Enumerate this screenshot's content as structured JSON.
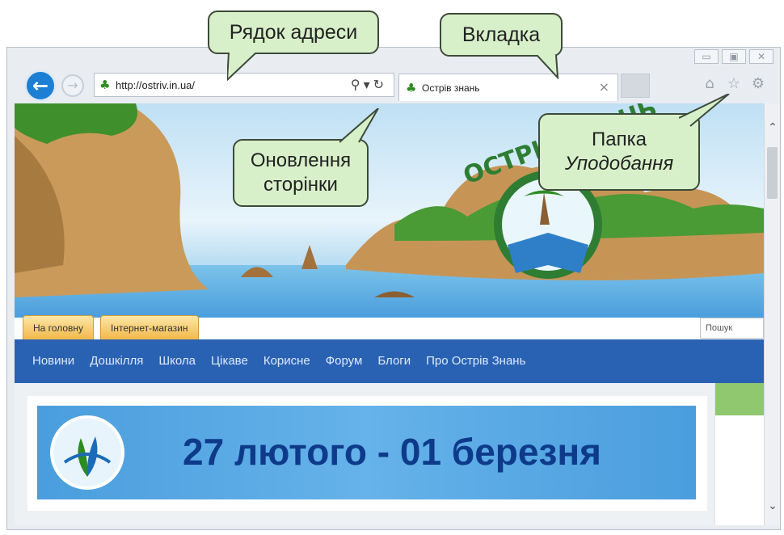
{
  "callouts": {
    "address_bar": "Рядок адреси",
    "tab": "Вкладка",
    "refresh_line1": "Оновлення",
    "refresh_line2": "сторінки",
    "favorites_line1": "Папка",
    "favorites_line2": "Уподобання"
  },
  "browser": {
    "url": "http://ostriv.in.ua/",
    "tab_title": "Острів знань",
    "window_buttons": [
      "▭",
      "▣",
      "✕"
    ]
  },
  "site": {
    "logo_text": "ОСТРІВ ЗНАНЬ",
    "top_tabs": [
      "На головну",
      "Інтернет-магазин"
    ],
    "search_placeholder": "Пошук",
    "menu": [
      "Новини",
      "Дошкілля",
      "Школа",
      "Цікаве",
      "Корисне",
      "Форум",
      "Блоги",
      "Про Острів Знань"
    ],
    "banner_date": "27 лютого - 01 березня"
  },
  "colors": {
    "accent_blue": "#2a62b3",
    "callout_bg": "#d8f0c9",
    "banner_text": "#0e3a8a",
    "tab_yellow": "#f2b84a"
  }
}
